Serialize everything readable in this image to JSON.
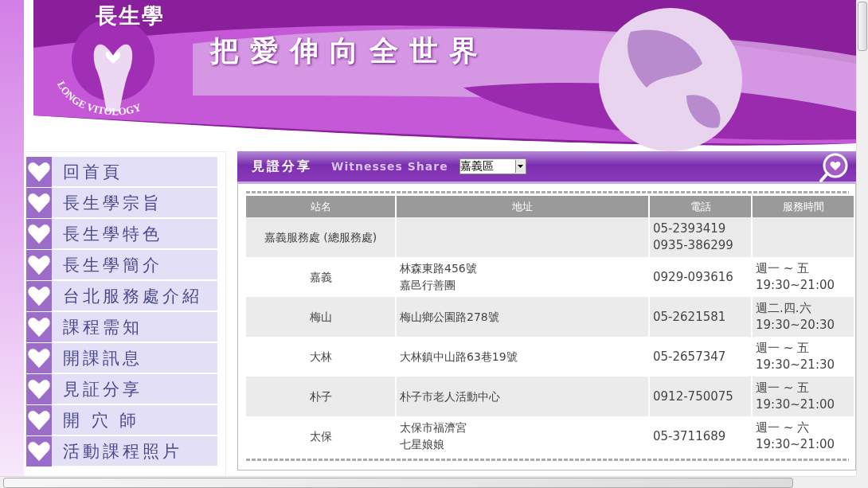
{
  "banner": {
    "logo_title": "長生學",
    "logo_subtitle": "LONGE VITOLOGY",
    "slogan": "把愛伸向全世界"
  },
  "sidebar": {
    "items": [
      {
        "label": "回首頁"
      },
      {
        "label": "長生學宗旨"
      },
      {
        "label": "長生學特色"
      },
      {
        "label": "長生學簡介"
      },
      {
        "label": "台北服務處介紹"
      },
      {
        "label": "課程需知"
      },
      {
        "label": "開課訊息"
      },
      {
        "label": "見証分享"
      },
      {
        "label": "開 穴 師"
      },
      {
        "label": "活動課程照片"
      }
    ]
  },
  "panel": {
    "title": "見證分享",
    "subtitle": "Witnesses Share",
    "region_select": {
      "value": "嘉義區"
    },
    "table": {
      "columns": [
        "站名",
        "地址",
        "電話",
        "服務時間"
      ],
      "rows": [
        {
          "station": "嘉義服務處 (總服務處)",
          "phone": [
            "05-2393419",
            "0935-386299"
          ]
        },
        {
          "station": "嘉義",
          "address": [
            "林森東路456號",
            "嘉邑行善團"
          ],
          "phone": [
            "0929-093616"
          ],
          "hours": [
            "週一 ~ 五",
            "19:30~21:00"
          ]
        },
        {
          "station": "梅山",
          "address": [
            "梅山鄉公園路278號"
          ],
          "phone": [
            "05-2621581"
          ],
          "hours": [
            "週二.四.六",
            "19:30~20:30"
          ]
        },
        {
          "station": "大林",
          "address": [
            "大林鎮中山路63巷19號"
          ],
          "phone": [
            "05-2657347"
          ],
          "hours": [
            "週一 ~ 五",
            "19:30~21:30"
          ]
        },
        {
          "station": "朴子",
          "address": [
            "朴子市老人活動中心"
          ],
          "phone": [
            "0912-750075"
          ],
          "hours": [
            "週一 ~ 五",
            "19:30~21:00"
          ]
        },
        {
          "station": "太保",
          "address": [
            "太保市福濟宮",
            "七星娘娘"
          ],
          "phone": [
            "05-3711689"
          ],
          "hours": [
            "週一 ~ 六",
            "19:30~21:00"
          ]
        }
      ]
    }
  }
}
